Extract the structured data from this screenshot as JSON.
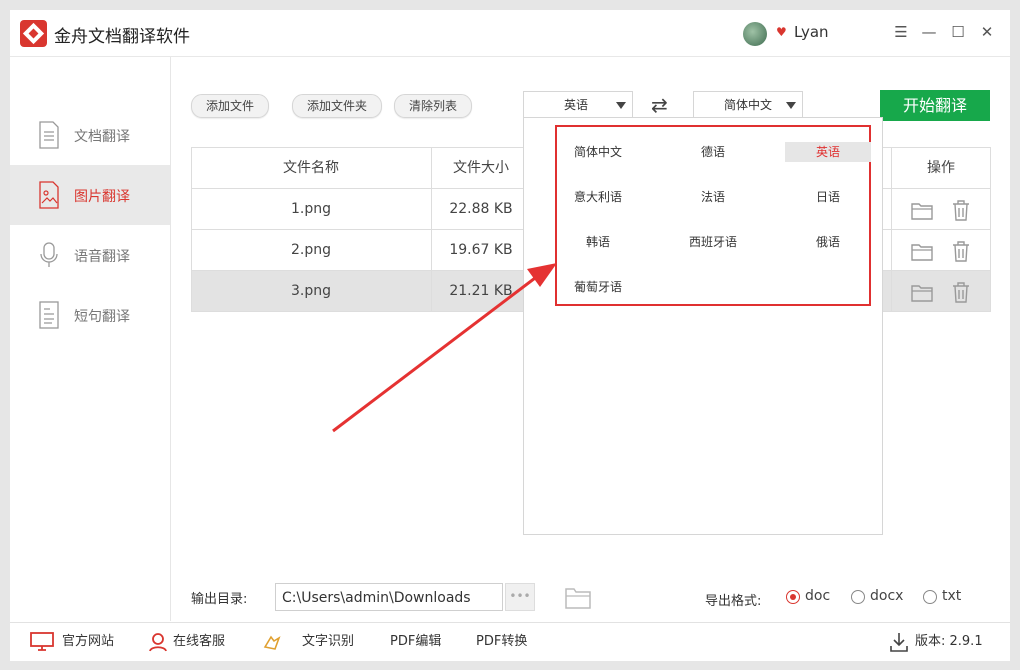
{
  "app": {
    "title": "金舟文档翻译软件",
    "username": "Lyan",
    "vip_icon": "heart-icon"
  },
  "window_controls": {
    "menu": "☰",
    "minimize": "—",
    "maximize": "☐",
    "close": "✕"
  },
  "sidebar": {
    "items": [
      {
        "label": "文档翻译",
        "icon": "document-icon",
        "active": false
      },
      {
        "label": "图片翻译",
        "icon": "image-icon",
        "active": true
      },
      {
        "label": "语音翻译",
        "icon": "microphone-icon",
        "active": false
      },
      {
        "label": "短句翻译",
        "icon": "text-icon",
        "active": false
      }
    ]
  },
  "toolbar": {
    "add_file": "添加文件",
    "add_folder": "添加文件夹",
    "clear_list": "清除列表",
    "source_lang": "英语",
    "target_lang": "简体中文",
    "start": "开始翻译"
  },
  "table": {
    "columns": {
      "name": "文件名称",
      "size": "文件大小",
      "ops": "操作"
    },
    "rows": [
      {
        "name": "1.png",
        "size": "22.88 KB",
        "selected": false
      },
      {
        "name": "2.png",
        "size": "19.67 KB",
        "selected": false
      },
      {
        "name": "3.png",
        "size": "21.21 KB",
        "selected": true
      }
    ]
  },
  "dropdown": {
    "options": [
      "简体中文",
      "德语",
      "英语",
      "意大利语",
      "法语",
      "日语",
      "韩语",
      "西班牙语",
      "俄语",
      "葡萄牙语"
    ],
    "selected": "英语"
  },
  "output": {
    "label": "输出目录:",
    "path": "C:\\Users\\admin\\Downloads",
    "dots": "•••"
  },
  "export": {
    "label": "导出格式:",
    "options": [
      "doc",
      "docx",
      "txt"
    ],
    "selected": "doc"
  },
  "bottom": {
    "website": "官方网站",
    "service": "在线客服",
    "ocr": "文字识别",
    "pdf_edit": "PDF编辑",
    "pdf_convert": "PDF转换",
    "version": "版本: 2.9.1"
  },
  "colors": {
    "accent": "#d9362f",
    "start_button": "#17a84b",
    "highlight_box": "#e03030"
  }
}
